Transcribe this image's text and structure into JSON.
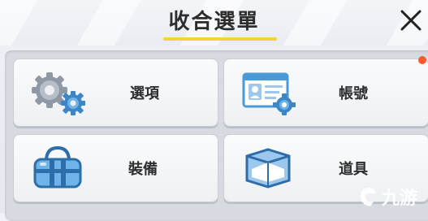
{
  "header": {
    "title": "收合選單"
  },
  "menu": {
    "items": [
      {
        "label": "選項",
        "icon": "gears-icon"
      },
      {
        "label": "帳號",
        "icon": "id-card-icon",
        "has_notification": true
      },
      {
        "label": "裝備",
        "icon": "bag-icon"
      },
      {
        "label": "道具",
        "icon": "box-icon"
      }
    ]
  },
  "watermark": {
    "text": "九游"
  },
  "colors": {
    "accent": "#f2d43a",
    "notification": "#ff5a2a",
    "icon_blue": "#4a9ad8"
  }
}
